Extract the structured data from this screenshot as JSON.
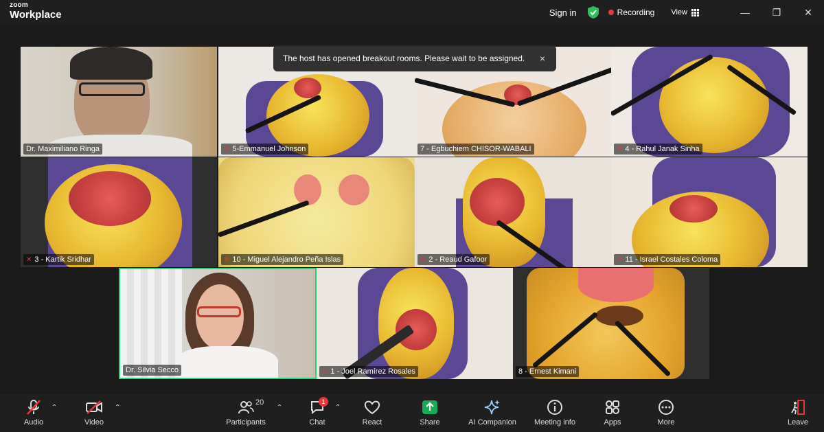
{
  "app": {
    "brand_top": "zoom",
    "brand_bottom": "Workplace"
  },
  "titlebar": {
    "signin": "Sign in",
    "recording": "Recording",
    "view": "View"
  },
  "notice": {
    "text": "The host has opened breakout rooms. Please wait to be assigned.",
    "close": "×"
  },
  "participants": [
    {
      "name": "Dr. Maximiliano Ringa",
      "muted": false
    },
    {
      "name": "5-Emmanuel Johnson",
      "muted": true
    },
    {
      "name": "7 - Egbuchiem CHISOR-WABALI",
      "muted": false
    },
    {
      "name": "4 - Rahul Janak Sinha",
      "muted": true
    },
    {
      "name": "3 - Kartik Sridhar",
      "muted": true
    },
    {
      "name": "10 - Miguel Alejandro Peña Islas",
      "muted": true
    },
    {
      "name": "2 - Reaud Gafoor",
      "muted": true
    },
    {
      "name": "11 - Israel Costales Coloma",
      "muted": true
    },
    {
      "name": "Dr. Silvia Secco",
      "muted": false,
      "active_speaker": true
    },
    {
      "name": "1 - Joel Ramírez Rosales",
      "muted": true
    },
    {
      "name": "8 - Ernest Kimani",
      "muted": false
    }
  ],
  "toolbar": {
    "audio": "Audio",
    "video": "Video",
    "participants": "Participants",
    "participants_count": "20",
    "chat": "Chat",
    "chat_badge": "1",
    "react": "React",
    "share": "Share",
    "ai_companion": "AI Companion",
    "meeting_info": "Meeting info",
    "apps": "Apps",
    "more": "More",
    "leave": "Leave"
  },
  "colors": {
    "recording": "#e5383b",
    "active_speaker_border": "#2fd07a",
    "share": "#1aaa55",
    "leave": "#e5383b"
  }
}
